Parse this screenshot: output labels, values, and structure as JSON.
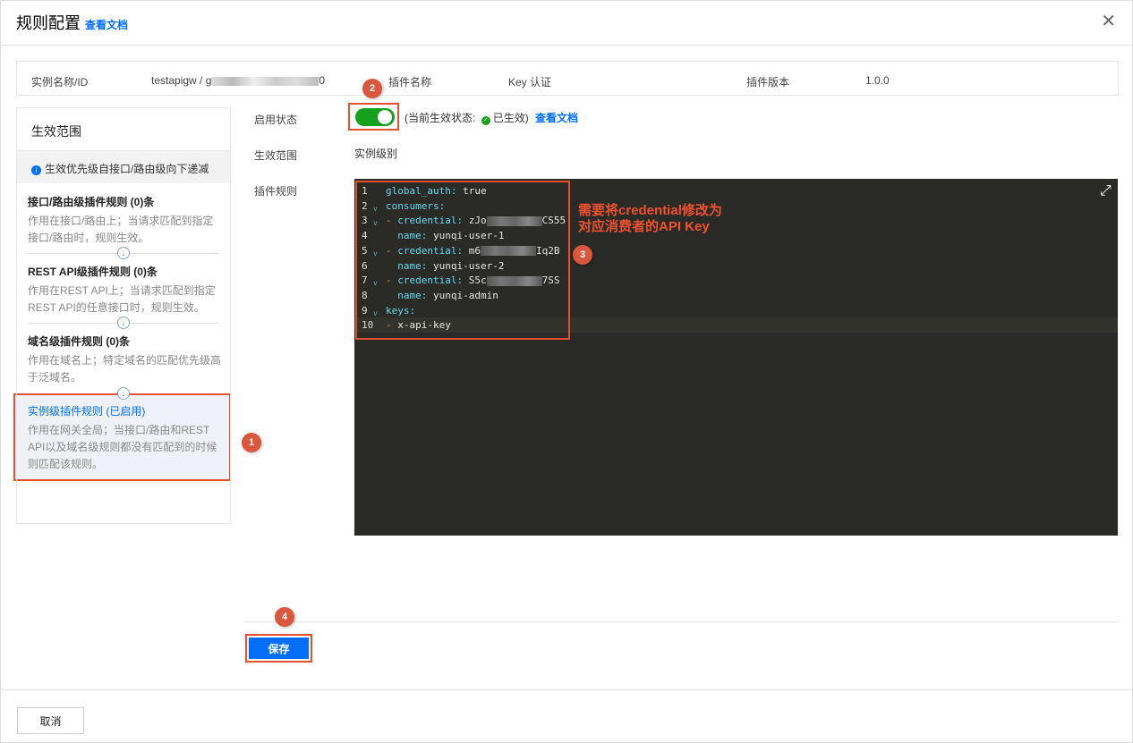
{
  "header": {
    "title": "规则配置",
    "doc_link": "查看文档",
    "close": "✕"
  },
  "info": {
    "instance_label": "实例名称/ID",
    "instance_value_prefix": "testapigw / g",
    "instance_value_suffix": "0",
    "plugin_name_label": "插件名称",
    "plugin_name": "Key 认证",
    "plugin_version_label": "插件版本",
    "plugin_version": "1.0.0"
  },
  "scope_panel": {
    "title": "生效范围",
    "tip": "生效优先级自接口/路由级向下递减",
    "rules": [
      {
        "title": "接口/路由级插件规则 (0)条",
        "desc": "作用在接口/路由上；当请求匹配到指定接口/路由时，规则生效。"
      },
      {
        "title": "REST API级插件规则 (0)条",
        "desc": "作用在REST API上；当请求匹配到指定REST API的任意接口时，规则生效。"
      },
      {
        "title": "域名级插件规则 (0)条",
        "desc": "作用在域名上；特定域名的匹配优先级高于泛域名。"
      },
      {
        "title": "实例级插件规则 (已启用)",
        "desc": "作用在网关全局；当接口/路由和REST API以及域名级规则都没有匹配到的时候则匹配该规则。"
      }
    ]
  },
  "form": {
    "enable_label": "启用状态",
    "enabled": true,
    "status_prefix": "(当前生效状态:",
    "status": "已生效)",
    "doc_link": "查看文档",
    "scope_label": "生效范围",
    "scope_value": "实例级别",
    "rules_label": "插件规则"
  },
  "editor": {
    "lines": [
      {
        "n": "1",
        "dash": "",
        "key": "global_auth",
        "val": " true",
        "fold": false,
        "blur": ""
      },
      {
        "n": "2",
        "dash": "",
        "key": "consumers",
        "val": "",
        "fold": true,
        "blur": ""
      },
      {
        "n": "3",
        "dash": "- ",
        "key": "credential",
        "val": " zJo",
        "val2": "CS55",
        "fold": true,
        "blur": "y"
      },
      {
        "n": "4",
        "dash": "  ",
        "key": "name",
        "val": " yunqi-user-1",
        "fold": false,
        "blur": ""
      },
      {
        "n": "5",
        "dash": "- ",
        "key": "credential",
        "val": " m6",
        "val2": "Iq2B",
        "fold": true,
        "blur": "y"
      },
      {
        "n": "6",
        "dash": "  ",
        "key": "name",
        "val": " yunqi-user-2",
        "fold": false,
        "blur": ""
      },
      {
        "n": "7",
        "dash": "- ",
        "key": "credential",
        "val": " S5c",
        "val2": "7SS",
        "fold": true,
        "blur": "y"
      },
      {
        "n": "8",
        "dash": "  ",
        "key": "name",
        "val": " yunqi-admin",
        "fold": false,
        "blur": ""
      },
      {
        "n": "9",
        "dash": "",
        "key": "keys",
        "val": "",
        "fold": true,
        "blur": ""
      },
      {
        "n": "10",
        "dash": "- ",
        "key": "",
        "val": "x-api-key",
        "fold": false,
        "blur": ""
      }
    ]
  },
  "annotations": {
    "b1": "1",
    "b2": "2",
    "b3": "3",
    "b4": "4",
    "note_line1": "需要将credential修改为",
    "note_line2": "对应消费者的API Key"
  },
  "footer": {
    "save": "保存",
    "cancel": "取消"
  }
}
